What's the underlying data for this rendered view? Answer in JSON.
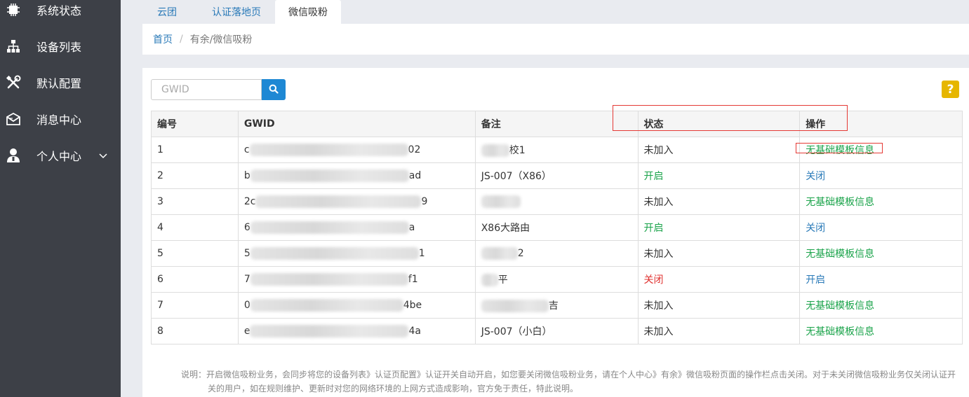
{
  "sidebar": {
    "items": [
      {
        "label": "系统状态",
        "icon": "chip-icon"
      },
      {
        "label": "设备列表",
        "icon": "sitemap-icon"
      },
      {
        "label": "默认配置",
        "icon": "tools-icon"
      },
      {
        "label": "消息中心",
        "icon": "envelope-icon"
      },
      {
        "label": "个人中心",
        "icon": "user-icon"
      }
    ]
  },
  "tabs": [
    "云团",
    "认证落地页",
    "微信吸粉"
  ],
  "breadcrumb": {
    "home": "首页",
    "separator": "/",
    "current": "有余/微信吸粉"
  },
  "search": {
    "placeholder": "GWID"
  },
  "help": {
    "label": "?"
  },
  "table": {
    "headers": [
      "编号",
      "GWID",
      "备注",
      "状态",
      "操作"
    ],
    "rows": [
      {
        "id": "1",
        "gwid_start": "c",
        "gwid_end": "02",
        "note_start": "",
        "note_end": "校1",
        "status": "未加入",
        "action": "无基础模板信息"
      },
      {
        "id": "2",
        "gwid_start": "b",
        "gwid_end": "ad",
        "note_start": "JS-007（X86）",
        "note_end": "",
        "status": "开启",
        "action": "关闭"
      },
      {
        "id": "3",
        "gwid_start": "2c",
        "gwid_end": "9",
        "note_start": "",
        "note_end": "",
        "status": "未加入",
        "action": "无基础模板信息"
      },
      {
        "id": "4",
        "gwid_start": "6",
        "gwid_end": "a",
        "note_start": "X86大路由",
        "note_end": "",
        "status": "开启",
        "action": "关闭"
      },
      {
        "id": "5",
        "gwid_start": "5",
        "gwid_end": "1",
        "note_start": "",
        "note_end": "2",
        "status": "未加入",
        "action": "无基础模板信息"
      },
      {
        "id": "6",
        "gwid_start": "7",
        "gwid_end": "f1",
        "note_start": "",
        "note_end": "平",
        "status": "关闭",
        "action": "开启"
      },
      {
        "id": "7",
        "gwid_start": "0",
        "gwid_end": "4be",
        "note_start": "",
        "note_end": "吉",
        "status": "未加入",
        "action": "无基础模板信息"
      },
      {
        "id": "8",
        "gwid_start": "e",
        "gwid_end": "4a",
        "note_start": "JS-007（小白）",
        "note_end": "",
        "status": "未加入",
        "action": "无基础模板信息"
      }
    ]
  },
  "note": {
    "label": "说明：",
    "line1": "开启微信吸粉业务，会同步将您的设备列表》认证页配置》认证开关自动开启，如您要关闭微信吸粉业务，请在个人中心》有余》微信吸粉页面的操作栏点击关闭。对于未关闭微信吸粉业务仅关闭认证开",
    "line2": "关的用户，如在规则维护、更新时对您的网络环境的上网方式造成影响，官方免于责任，特此说明。"
  },
  "colors": {
    "sidebar_bg": "#3d4047",
    "link_blue": "#2a7ab8",
    "status_green": "#1aa34a",
    "status_red": "#e0312f",
    "search_btn": "#1e88d4",
    "help_btn": "#e6b600",
    "annotation_red": "#e53935"
  }
}
